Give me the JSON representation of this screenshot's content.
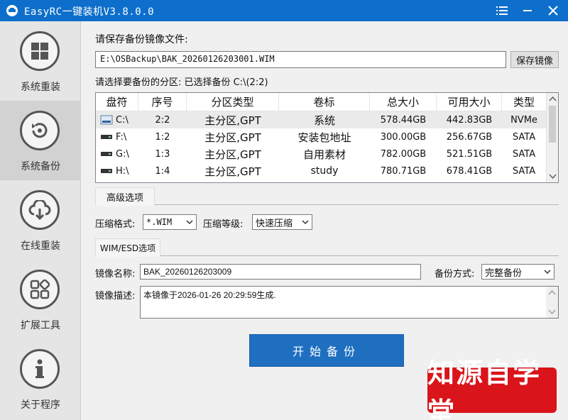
{
  "window": {
    "title": "EasyRC一键装机V3.8.0.0"
  },
  "sidebar": {
    "items": [
      {
        "label": "系统重装",
        "icon": "windows-icon",
        "active": false
      },
      {
        "label": "系统备份",
        "icon": "backup-icon",
        "active": true
      },
      {
        "label": "在线重装",
        "icon": "cloud-icon",
        "active": false
      },
      {
        "label": "扩展工具",
        "icon": "tools-icon",
        "active": false
      },
      {
        "label": "关于程序",
        "icon": "info-icon",
        "active": false
      }
    ]
  },
  "backup": {
    "save_file_label": "请保存备份镜像文件:",
    "file_path": "E:\\OSBackup\\BAK_20260126203001.WIM",
    "save_button": "保存镜像",
    "partition_prompt": "请选择要备份的分区: 已选择备份 C:\\(2:2)"
  },
  "partition_table": {
    "columns": [
      "盘符",
      "序号",
      "分区类型",
      "卷标",
      "总大小",
      "可用大小",
      "类型"
    ],
    "rows": [
      {
        "drive": "C:\\",
        "index": "2:2",
        "ptype": "主分区,GPT",
        "label": "系统",
        "total": "578.44GB",
        "free": "442.83GB",
        "kind": "NVMe",
        "selected": true
      },
      {
        "drive": "F:\\",
        "index": "1:2",
        "ptype": "主分区,GPT",
        "label": "安装包地址",
        "total": "300.00GB",
        "free": "256.67GB",
        "kind": "SATA",
        "selected": false
      },
      {
        "drive": "G:\\",
        "index": "1:3",
        "ptype": "主分区,GPT",
        "label": "自用素材",
        "total": "782.00GB",
        "free": "521.51GB",
        "kind": "SATA",
        "selected": false
      },
      {
        "drive": "H:\\",
        "index": "1:4",
        "ptype": "主分区,GPT",
        "label": "study",
        "total": "780.71GB",
        "free": "678.41GB",
        "kind": "SATA",
        "selected": false
      }
    ]
  },
  "advanced": {
    "section_title": "高级选项",
    "compress_format_label": "压缩格式:",
    "compress_format_value": "*.WIM",
    "compress_level_label": "压缩等级:",
    "compress_level_value": "快速压缩"
  },
  "wim": {
    "section_title": "WIM/ESD选项",
    "image_name_label": "镜像名称:",
    "image_name_value": "BAK_20260126203009",
    "backup_mode_label": "备份方式:",
    "backup_mode_value": "完整备份",
    "image_desc_label": "镜像描述:",
    "image_desc_value": "本镜像于2026-01-26 20:29:59生成."
  },
  "start_button": "开始备份",
  "watermark": "知源自学堂",
  "colors": {
    "titlebar": "#0d6fcb",
    "start_button": "#1f6fc1",
    "watermark": "#d9141a"
  }
}
